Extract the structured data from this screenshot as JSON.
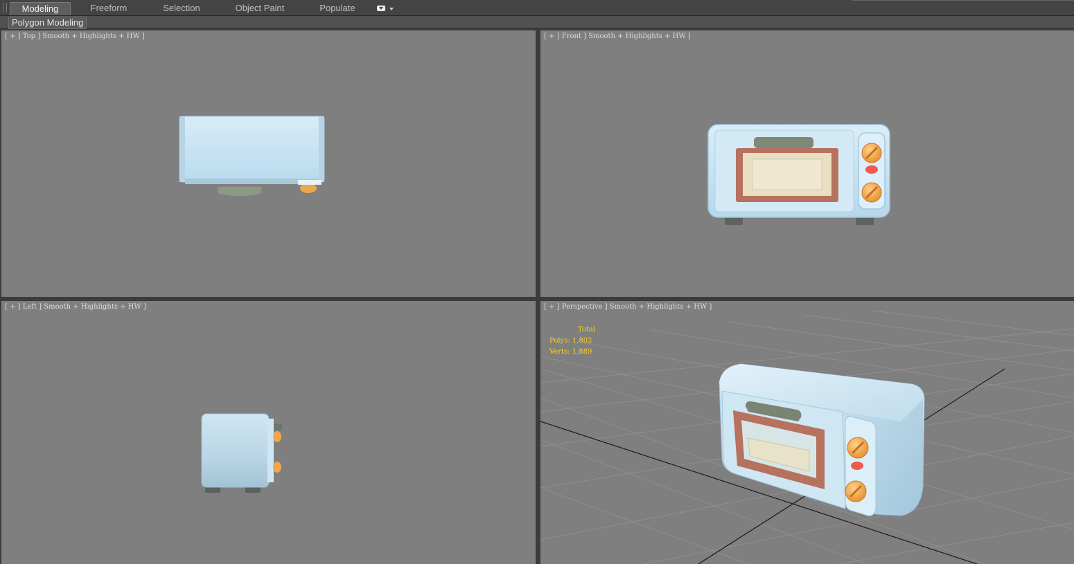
{
  "ribbon": {
    "tabs": [
      {
        "label": "Modeling",
        "active": true
      },
      {
        "label": "Freeform",
        "active": false
      },
      {
        "label": "Selection",
        "active": false
      },
      {
        "label": "Object Paint",
        "active": false
      },
      {
        "label": "Populate",
        "active": false
      }
    ],
    "panel_label": "Polygon Modeling"
  },
  "viewports": {
    "top": {
      "label": "[ + ] Top ] Smooth + Highlights + HW ]"
    },
    "front": {
      "label": "[ + ] Front ] Smooth + Highlights + HW ]"
    },
    "left": {
      "label": "[ + ] Left ] Smooth + Highlights + HW ]"
    },
    "perspective": {
      "label": "[ + ] Perspective ] Smooth + Highlights + HW ]",
      "stats": {
        "total_label": "Total",
        "polys": "Polys: 1,802",
        "verts": "Verts: 1,889"
      }
    }
  },
  "colors": {
    "viewport_bg": "#7f7f7f",
    "body_blue": "#c9e4f3",
    "knob_orange": "#f0a64a",
    "frame_brown": "#b87464",
    "stats_yellow": "#ffd21a"
  }
}
